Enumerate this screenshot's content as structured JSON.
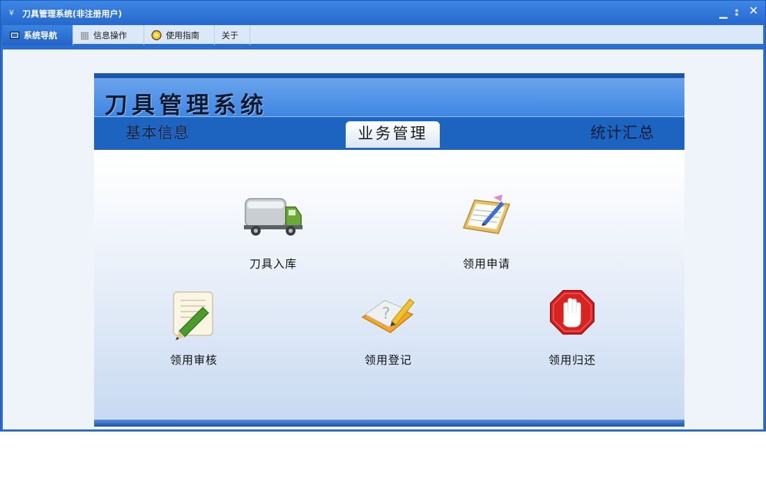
{
  "window": {
    "title": "刀具管理系统(非注册用户)",
    "accent": "#2a6fd0"
  },
  "menubar": {
    "items": [
      {
        "label": "系统导航",
        "icon": "monitor-icon",
        "active": true
      },
      {
        "label": "信息操作",
        "icon": "grid-icon",
        "active": false
      },
      {
        "label": "使用指南",
        "icon": "help-circle-icon",
        "active": false
      },
      {
        "label": "关于",
        "icon": "",
        "active": false
      }
    ]
  },
  "panel": {
    "title": "刀具管理系统",
    "tabs": [
      {
        "label": "基本信息",
        "selected": false
      },
      {
        "label": "业务管理",
        "selected": true
      },
      {
        "label": "统计汇总",
        "selected": false
      }
    ],
    "functions": [
      {
        "label": "刀具入库",
        "icon": "truck-icon"
      },
      {
        "label": "领用申请",
        "icon": "clipboard-pen-icon"
      },
      {
        "label": "领用审核",
        "icon": "document-pencil-icon"
      },
      {
        "label": "领用登记",
        "icon": "open-book-pencil-icon"
      },
      {
        "label": "领用归还",
        "icon": "stop-hand-icon"
      }
    ]
  }
}
